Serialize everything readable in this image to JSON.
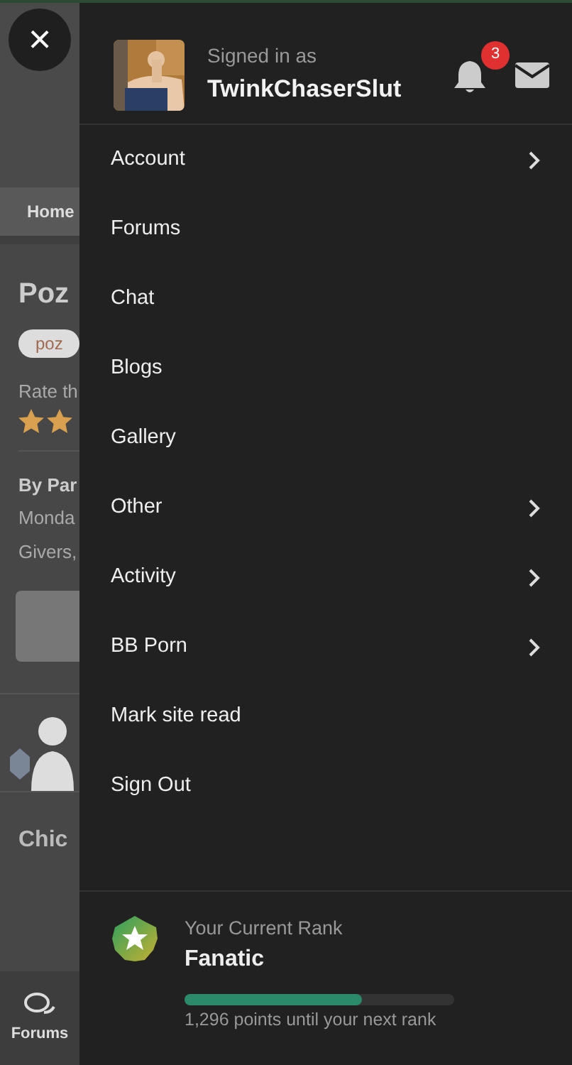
{
  "background_page": {
    "breadcrumb": "Home",
    "title": "Poz",
    "tag": "poz",
    "rate_label": "Rate th",
    "author": "By Par",
    "date": "Monda",
    "category": "Givers,",
    "next_title": "Chic",
    "bottom_tab": "Forums"
  },
  "close_button": {
    "label": "×"
  },
  "user": {
    "signed_in_label": "Signed in as",
    "username": "TwinkChaserSlut",
    "notification_count": "3"
  },
  "menu": [
    {
      "label": "Account",
      "expandable": true
    },
    {
      "label": "Forums",
      "expandable": false
    },
    {
      "label": "Chat",
      "expandable": false
    },
    {
      "label": "Blogs",
      "expandable": false
    },
    {
      "label": "Gallery",
      "expandable": false
    },
    {
      "label": "Other",
      "expandable": true
    },
    {
      "label": "Activity",
      "expandable": true
    },
    {
      "label": "BB Porn",
      "expandable": true
    },
    {
      "label": "Mark site read",
      "expandable": false
    },
    {
      "label": "Sign Out",
      "expandable": false
    }
  ],
  "rank": {
    "label": "Your Current Rank",
    "name": "Fanatic",
    "level": 0.66,
    "points_text": "1,296 points until your next rank"
  }
}
